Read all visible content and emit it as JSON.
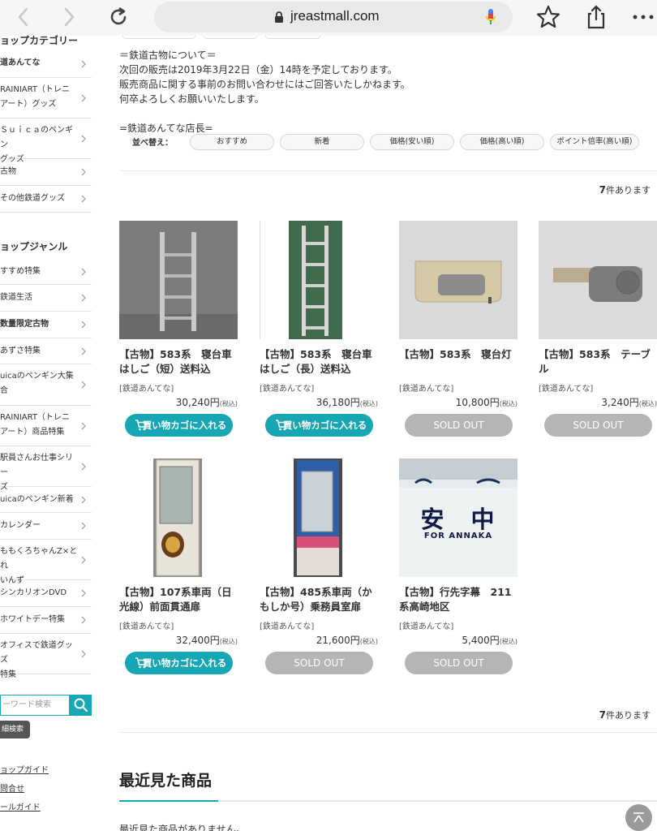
{
  "browser": {
    "url": "jreastmall.com",
    "back_icon": "chevron-left-icon",
    "forward_icon": "chevron-right-icon",
    "reload_icon": "reload-icon",
    "bookmark_icon": "star-icon",
    "share_icon": "share-icon",
    "more_icon": "more-icon"
  },
  "sidebar": {
    "category_title": "ョップカテゴリー",
    "categories": [
      {
        "label": "道あんてな"
      },
      {
        "label": "RAINIART（トレニ\nアート）グッズ"
      },
      {
        "label": "Ｓｕｉｃａのペンギン\nグッズ"
      },
      {
        "label": "古物"
      },
      {
        "label": "その他鉄道グッズ"
      }
    ],
    "genre_title": "ョップジャンル",
    "genres": [
      {
        "label": "すすめ特集"
      },
      {
        "label": "鉄道生活"
      },
      {
        "label": "数量限定古物"
      },
      {
        "label": "あずさ特集"
      },
      {
        "label": "uicaのペンギン大集\n合"
      },
      {
        "label": "RAINIART（トレニ\nアート）商品特集"
      },
      {
        "label": "駅員さんお仕事シリー\nズ"
      },
      {
        "label": "uicaのペンギン新着"
      },
      {
        "label": "カレンダー"
      },
      {
        "label": "ももくろちゃんZ×とれ\nいんず"
      },
      {
        "label": "シンカリオンDVD"
      },
      {
        "label": "ホワイトデー特集"
      },
      {
        "label": "オフィスで鉄道グッズ\n特集"
      }
    ],
    "search_placeholder": "ーワード検索",
    "advanced_search": "細検索",
    "links": [
      "ョップガイド",
      "問合せ",
      "ールガイド"
    ]
  },
  "main": {
    "intro_lines": [
      "＝鉄道古物について＝",
      "次回の販売は2019年3月22日（金）14時を予定しております。",
      "販売商品に関する事前のお問い合わせにはご回答いたしかねます。",
      "何卒よろしくお願いいたします。",
      "=鉄道あんてな店長="
    ],
    "sort_label": "並べ替え：",
    "sort_options": [
      "おすすめ",
      "新着",
      "価格(安い順)",
      "価格(高い順)",
      "ポイント倍率(高い順)"
    ],
    "count_num": "7",
    "count_suffix": "件あります",
    "cart_label": "買い物カゴに入れる",
    "sold_label": "SOLD OUT",
    "tax_label": "(税込)",
    "products": [
      {
        "title": "【古物】583系　寝台車はしご（短）送料込",
        "shop": "[鉄道あんてな]",
        "price": "30,240円",
        "status": "cart"
      },
      {
        "title": "【古物】583系　寝台車はしご（長）送料込",
        "shop": "[鉄道あんてな]",
        "price": "36,180円",
        "status": "cart"
      },
      {
        "title": "【古物】583系　寝台灯",
        "shop": "[鉄道あんてな]",
        "price": "10,800円",
        "status": "sold"
      },
      {
        "title": "【古物】583系　テーブル",
        "shop": "[鉄道あんてな]",
        "price": "3,240円",
        "status": "sold"
      },
      {
        "title": "【古物】107系車両（日光線）前面貫通扉",
        "shop": "[鉄道あんてな]",
        "price": "32,400円",
        "status": "cart"
      },
      {
        "title": "【古物】485系車両（かもしか号）乗務員室扉",
        "shop": "[鉄道あんてな]",
        "price": "21,600円",
        "status": "sold"
      },
      {
        "title": "【古物】行先字幕　211系高崎地区",
        "shop": "[鉄道あんてな]",
        "price": "5,400円",
        "status": "sold"
      }
    ],
    "sign_text_kanji": "安　中",
    "sign_text_roman": "FOR ANNAKA",
    "recent_title": "最近見た商品",
    "recent_empty": "最近見た商品がありません。"
  },
  "colors": {
    "accent": "#17a6b4",
    "sold": "#b5b5b5"
  }
}
